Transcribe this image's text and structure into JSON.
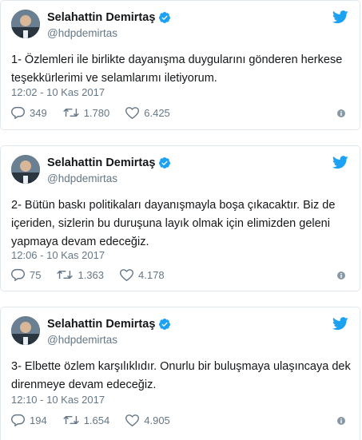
{
  "tweets": [
    {
      "name": "Selahattin Demirtaş",
      "handle": "@hdpdemirtas",
      "text": "1- Özlemleri ile birlikte dayanışma duygularını gönderen herkese teşekkürlerimi ve selamlarımı iletiyorum.",
      "time": "12:02 - 10 Kas 2017",
      "replies": "349",
      "retweets": "1.780",
      "likes": "6.425"
    },
    {
      "name": "Selahattin Demirtaş",
      "handle": "@hdpdemirtas",
      "text": "2- Bütün baskı politikaları dayanışmayla boşa çıkacaktır. Biz de içeriden, sizlerin bu duruşuna layık olmak için elimizden geleni yapmaya devam edeceğiz.",
      "time": "12:06 - 10 Kas 2017",
      "replies": "75",
      "retweets": "1.363",
      "likes": "4.178"
    },
    {
      "name": "Selahattin Demirtaş",
      "handle": "@hdpdemirtas",
      "text": "3- Elbette özlem karşılıklıdır. Onurlu bir buluşmaya ulaşıncaya dek direnmeye devam edeceğiz.",
      "time": "12:10 - 10 Kas 2017",
      "replies": "194",
      "retweets": "1.654",
      "likes": "4.905"
    }
  ],
  "icons": {
    "verified": "verified-badge-icon",
    "bird": "twitter-bird-icon",
    "reply": "reply-icon",
    "retweet": "retweet-icon",
    "like": "heart-icon",
    "info": "info-icon"
  },
  "colors": {
    "brand": "#1da1f2",
    "muted": "#657786",
    "text": "#14171a",
    "border": "#e1e8ed"
  }
}
